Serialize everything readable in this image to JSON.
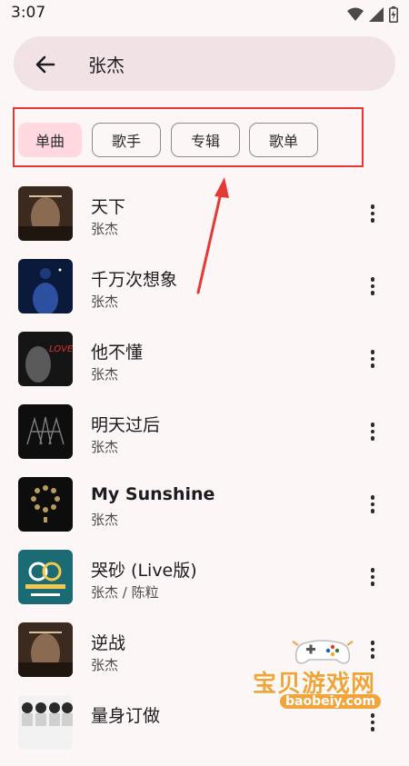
{
  "status_bar": {
    "time": "3:07",
    "icons": [
      "wifi-icon",
      "signal-icon",
      "battery-icon"
    ]
  },
  "search": {
    "query": "张杰",
    "back_icon": "arrow-left-icon"
  },
  "filters": [
    {
      "label": "单曲",
      "selected": true
    },
    {
      "label": "歌手",
      "selected": false
    },
    {
      "label": "专辑",
      "selected": false
    },
    {
      "label": "歌单",
      "selected": false
    }
  ],
  "annotation_color": "#e53935",
  "songs": [
    {
      "title": "天下",
      "artist": "张杰"
    },
    {
      "title": "千万次想象",
      "artist": "张杰"
    },
    {
      "title": "他不懂",
      "artist": "张杰"
    },
    {
      "title": "明天过后",
      "artist": "张杰"
    },
    {
      "title": "My Sunshine",
      "artist": "张杰"
    },
    {
      "title": "哭砂 (Live版)",
      "artist": "张杰 / 陈粒"
    },
    {
      "title": "逆战",
      "artist": "张杰"
    },
    {
      "title": "量身订做",
      "artist": ""
    }
  ],
  "watermark": {
    "text": "宝贝游戏网",
    "url": "baobeiy.com"
  }
}
